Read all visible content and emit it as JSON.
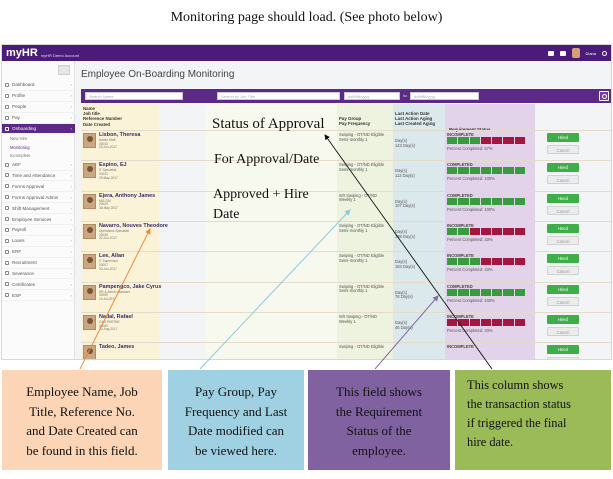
{
  "caption": "Monitoring page should load. (See photo below)",
  "app": {
    "brand": "myHR",
    "brand_sub": "myHR Demo Account",
    "user": "Diana"
  },
  "sidebar": {
    "items": [
      {
        "label": "Dashboard"
      },
      {
        "label": "Profile"
      },
      {
        "label": "People"
      },
      {
        "label": "Pay"
      },
      {
        "label": "Onboarding"
      },
      {
        "label": "New Hire",
        "sub": true
      },
      {
        "label": "Monitoring",
        "sub": true
      },
      {
        "label": "Incomplete",
        "sub": true
      },
      {
        "label": "AEF"
      },
      {
        "label": "Time and Attendance"
      },
      {
        "label": "Forms Approval"
      },
      {
        "label": "Forms Approval Admin"
      },
      {
        "label": "Shift Management"
      },
      {
        "label": "Employee Services"
      },
      {
        "label": "Payroll"
      },
      {
        "label": "Loans"
      },
      {
        "label": "ERF"
      },
      {
        "label": "Recruitment"
      },
      {
        "label": "Severance"
      },
      {
        "label": "Certificates"
      },
      {
        "label": "ESP"
      }
    ]
  },
  "main": {
    "title": "Employee On-Boarding Monitoring",
    "filters": {
      "search_name": "Search Name",
      "search_job": "Search by Job Title",
      "date_from": "dd/MM/yyyy",
      "separator": "to",
      "date_to": "dd/MM/yyyy"
    },
    "headers": {
      "employee": [
        "Name",
        "Job title",
        "Reference Number",
        "Date Created"
      ],
      "pay": [
        "Pay Group",
        "Pay Frequency"
      ],
      "last": [
        "Last Action Date",
        "Last Action Aging",
        "Last Created Aging"
      ],
      "requirement": "Requirement Status"
    },
    "actions": {
      "hired": "Hired",
      "cancel": "Cancel"
    },
    "rows": [
      {
        "name": "Lisbon, Theresa",
        "job": "Admin Staff",
        "ref": "00043",
        "date": "15-Jun-2017",
        "pay_group": "Swiping - OT/ND Eligible",
        "pay_freq": "Semi-monthly 1",
        "last1": "Day(s)",
        "last2": "143 Day(s)",
        "status": "INCOMPLETE",
        "segs": [
          "g",
          "g",
          "g",
          "r",
          "r",
          "r",
          "r"
        ],
        "pct": "Percent Completed: 57%"
      },
      {
        "name": "Espino, EJ",
        "job": "IT Specialist",
        "ref": "00031",
        "date": "29-May-2017",
        "pay_group": "Swiping - OT/ND Eligible",
        "pay_freq": "Semi-monthly 1",
        "last1": "Day(s)",
        "last2": "112 Day(s)",
        "status": "COMPLETED",
        "segs": [
          "g",
          "g",
          "g",
          "g",
          "g",
          "g",
          "g"
        ],
        "pct": "Percent Completed: 100%"
      },
      {
        "name": "Ejera, Anthony James",
        "job": "MIS GM",
        "ref": "00029",
        "date": "30-May-2017",
        "pay_group": "W/I Swiping - OT/ND",
        "pay_freq": "Weekly 1",
        "last1": "Day(s)",
        "last2": "107 Day(s)",
        "status": "COMPLETED",
        "segs": [
          "g",
          "g",
          "g",
          "g",
          "g",
          "g",
          "g"
        ],
        "pct": "Percent Completed: 100%"
      },
      {
        "name": "Navarro, Nouves Theodore",
        "job": "Operations Specialist",
        "ref": "00036",
        "date": "30-Jun-2017",
        "pay_group": "Swiping - OT/ND Eligible",
        "pay_freq": "Semi-monthly 1",
        "last1": "Day(s)",
        "last2": "188 Day(s)",
        "status": "INCOMPLETE",
        "segs": [
          "g",
          "g",
          "r",
          "r",
          "r",
          "r",
          "r"
        ],
        "pct": "Percent Completed: 33%"
      },
      {
        "name": "Lee, Allan",
        "job": "IT Supervisor",
        "ref": "00007",
        "date": "30-Jun-2017",
        "pay_group": "Swiping - OT/ND Eligible",
        "pay_freq": "Semi-monthly 1",
        "last1": "Day(s)",
        "last2": "184 Day(s)",
        "status": "INCOMPLETE",
        "segs": [
          "g",
          "g",
          "g",
          "r",
          "r",
          "r",
          "r"
        ],
        "pct": "Percent Completed: 33%"
      },
      {
        "name": "Pampengco, Jake Cyrus",
        "job": "HR & Admin Assistant",
        "ref": "00050",
        "date": "10-Jul-2017",
        "pay_group": "Swiping - OT/ND Eligible",
        "pay_freq": "Semi-monthly 1",
        "last1": "Day(s)",
        "last2": "78 Day(s)",
        "status": "COMPLETED",
        "segs": [
          "g",
          "g",
          "g",
          "g",
          "g",
          "g",
          "g"
        ],
        "pct": "Percent Completed: 100%"
      },
      {
        "name": "Nadal, Rafael",
        "job": "CAM PARTNE",
        "ref": "00060",
        "date": "10-Aug-2017",
        "pay_group": "W/I Swiping - OT/ND",
        "pay_freq": "Weekly 1",
        "last1": "Day(s)",
        "last2": "46 Day(s)",
        "status": "INCOMPLETE",
        "segs": [
          "r",
          "r",
          "r",
          "r",
          "r",
          "r",
          "r"
        ],
        "pct": "Percent Completed: 33%"
      },
      {
        "name": "Tadeo, James",
        "job": "",
        "ref": "",
        "date": "",
        "pay_group": "Swiping - OT/ND Eligible",
        "pay_freq": "",
        "last1": "",
        "last2": "",
        "status": "INCOMPLETE",
        "segs": [],
        "pct": ""
      }
    ]
  },
  "annotations": {
    "status": "Status of Approval",
    "for_approval": "For Approval/Date",
    "approved": "Approved + Hire",
    "date": "Date"
  },
  "boxes": [
    {
      "lines": [
        "Employee Name, Job",
        "Title, Reference No.",
        "and Date Created can",
        "be found in this field."
      ]
    },
    {
      "lines": [
        "Pay Group, Pay",
        "Frequency and Last",
        "Date modified can",
        "be viewed here."
      ]
    },
    {
      "lines": [
        "This field shows",
        "the Requirement",
        "Status of the",
        "employee."
      ]
    },
    {
      "lines": [
        "This column shows",
        "the transaction status",
        "if triggered the final",
        "hire date."
      ]
    }
  ],
  "colors": {
    "topbar": "#4a1b78",
    "accent": "#5b2a86",
    "segment_green": "#3a9a3f",
    "segment_red": "#a3163f",
    "hired_button": "#3fae49",
    "box_employee": "#fbd5b5",
    "box_pay": "#9fd1e3",
    "box_requirement": "#8062a0",
    "box_status": "#9bbb59"
  }
}
